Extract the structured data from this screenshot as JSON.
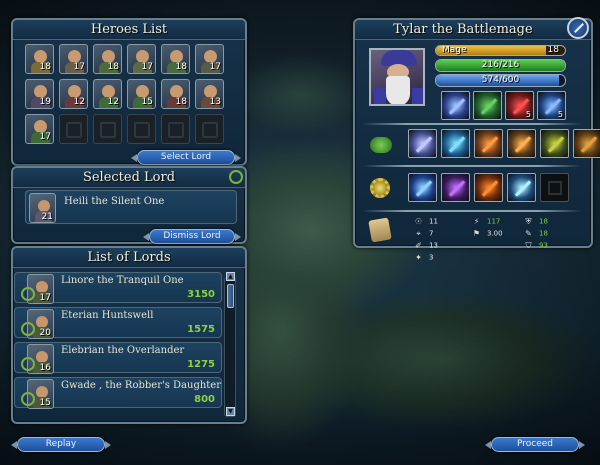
{
  "heroes_panel": {
    "title": "Heroes List",
    "heroes": [
      {
        "level": "18",
        "color": "#7a6a3a"
      },
      {
        "level": "17",
        "color": "#6a5d4a"
      },
      {
        "level": "18",
        "color": "#4d6a3a"
      },
      {
        "level": "17",
        "color": "#5c6a4a"
      },
      {
        "level": "18",
        "color": "#4a6a3f"
      },
      {
        "level": "17",
        "color": "#5a5a4a"
      },
      {
        "level": "19",
        "color": "#4d4a6a"
      },
      {
        "level": "12",
        "color": "#6a3a3a"
      },
      {
        "level": "12",
        "color": "#3e6a3a"
      },
      {
        "level": "15",
        "color": "#3e6a3a"
      },
      {
        "level": "18",
        "color": "#6a3a3a"
      },
      {
        "level": "13",
        "color": "#6a4a3a"
      },
      {
        "level": "17",
        "color": "#3f6a35"
      },
      {
        "level": "",
        "empty": true
      },
      {
        "level": "",
        "empty": true
      },
      {
        "level": "",
        "empty": true
      },
      {
        "level": "",
        "empty": true
      },
      {
        "level": "",
        "empty": true
      }
    ],
    "select_button": "Select Lord"
  },
  "selected_panel": {
    "title": "Selected Lord",
    "lord_name": "Heili the Silent One",
    "lord_level": "21",
    "dismiss_button": "Dismiss Lord"
  },
  "lords_panel": {
    "title": "List of Lords",
    "lords": [
      {
        "name": "Linore the Tranquil One",
        "level": "17",
        "gold": "3150"
      },
      {
        "name": "Eterian Huntswell",
        "level": "20",
        "gold": "1575"
      },
      {
        "name": "Elebrian the Overlander",
        "level": "16",
        "gold": "1275"
      },
      {
        "name": "Gwade , the Robber's Daughter",
        "level": "15",
        "gold": "800"
      }
    ]
  },
  "hero_panel": {
    "title": "Tylar the Battlemage",
    "class_name": "Mage",
    "level": "18",
    "xp_fraction": 0.85,
    "hp_text": "216/216",
    "hp_fraction": 1.0,
    "mana_text": "574/600",
    "mana_fraction": 0.957,
    "items": [
      {
        "count": "",
        "color": "#2a3f8a",
        "glow": "#9fc0ff"
      },
      {
        "count": "",
        "color": "#1f5a2a",
        "glow": "#66d060"
      },
      {
        "count": "5",
        "color": "#6a1a1a",
        "glow": "#ff5050"
      },
      {
        "count": "5",
        "color": "#1a3f7a",
        "glow": "#8ab8ff"
      }
    ],
    "equipment": [
      {
        "color": "#3f4a8a",
        "glow": "#c0c8ff"
      },
      {
        "color": "#1a5a8a",
        "glow": "#7fe0ff"
      },
      {
        "color": "#6a3a1a",
        "glow": "#ff9a40"
      },
      {
        "color": "#5a3a1a",
        "glow": "#ffb050"
      },
      {
        "color": "#3a4a1a",
        "glow": "#c8d040"
      },
      {
        "color": "#5a3a10",
        "glow": "#e0a040"
      }
    ],
    "spells": [
      {
        "color": "#1a3f8a",
        "glow": "#8fd0ff",
        "empty": false
      },
      {
        "color": "#3a1a5a",
        "glow": "#c070ff",
        "empty": false
      },
      {
        "color": "#6a2a0a",
        "glow": "#ff8a30",
        "empty": false
      },
      {
        "color": "#1a4a7a",
        "glow": "#b0f0ff",
        "empty": false
      },
      {
        "color": "#111",
        "glow": "#333",
        "empty": true
      }
    ],
    "stats_col1": [
      "11",
      "7",
      "13",
      "3"
    ],
    "stats_col2": [
      "117",
      "3.00"
    ],
    "stats_col3": [
      "18",
      "18",
      "93"
    ]
  },
  "footer": {
    "replay_button": "Replay",
    "proceed_button": "Proceed"
  },
  "colors": {
    "xp_bar": "#d4a020",
    "hp_bar": "#38a838",
    "mana_bar": "#3a7ad0",
    "gold_text": "#8fd040"
  }
}
